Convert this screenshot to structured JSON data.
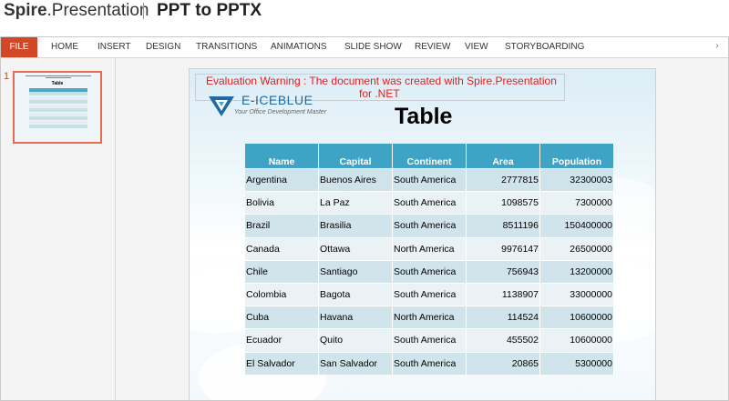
{
  "brand": {
    "logo_bold": "Spire",
    "logo_rest": ".Presentation",
    "title": "PPT to PPTX"
  },
  "ribbon": {
    "tabs": [
      "FILE",
      "HOME",
      "INSERT",
      "DESIGN",
      "TRANSITIONS",
      "ANIMATIONS",
      "SLIDE SHOW",
      "REVIEW",
      "VIEW",
      "STORYBOARDING"
    ]
  },
  "thumbnails": {
    "slide_number": "1",
    "thumb_title": "Table"
  },
  "slide": {
    "warning_line1": "Evaluation Warning : The document was created with  Spire.Presentation",
    "warning_line2": "for .NET",
    "logo_name": "E-ICEBLUE",
    "logo_tagline": "Your Office Development Master",
    "title": "Table",
    "table": {
      "headers": [
        "Name",
        "Capital",
        "Continent",
        "Area",
        "Population"
      ],
      "rows": [
        [
          "Argentina",
          "Buenos Aires",
          "South America",
          "2777815",
          "32300003"
        ],
        [
          "Bolivia",
          "La Paz",
          "South America",
          "1098575",
          "7300000"
        ],
        [
          "Brazil",
          "Brasilia",
          "South America",
          "8511196",
          "150400000"
        ],
        [
          "Canada",
          "Ottawa",
          "North America",
          "9976147",
          "26500000"
        ],
        [
          "Chile",
          "Santiago",
          "South America",
          "756943",
          "13200000"
        ],
        [
          "Colombia",
          "Bagota",
          "South America",
          "1138907",
          "33000000"
        ],
        [
          "Cuba",
          "Havana",
          "North America",
          "114524",
          "10600000"
        ],
        [
          "Ecuador",
          "Quito",
          "South America",
          "455502",
          "10600000"
        ],
        [
          "El Salvador",
          "San Salvador",
          "South America",
          "20865",
          "5300000"
        ]
      ]
    }
  },
  "colors": {
    "file_tab": "#d24726",
    "table_header": "#3fa3c6",
    "warning_text": "#e02020"
  }
}
